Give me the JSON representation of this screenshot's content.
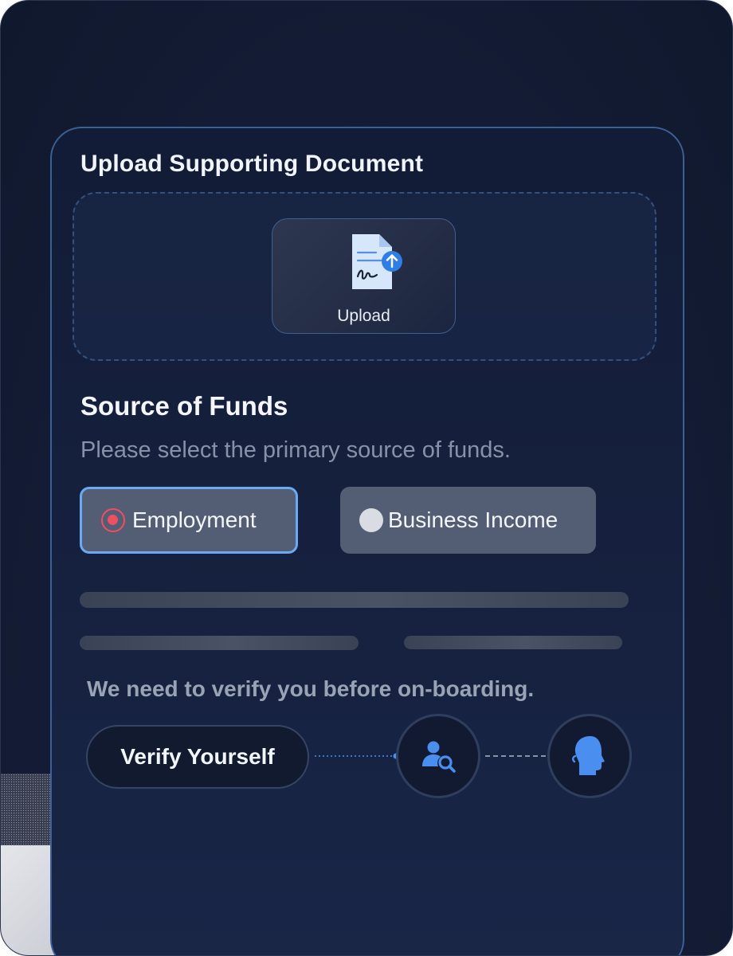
{
  "upload": {
    "title": "Upload Supporting Document",
    "button_label": "Upload",
    "icon": "document-upload-icon"
  },
  "source_of_funds": {
    "title": "Source of Funds",
    "subtitle": "Please select the primary source of funds.",
    "options": [
      {
        "label": "Employment",
        "selected": true
      },
      {
        "label": "Business Income",
        "selected": false
      }
    ]
  },
  "verification": {
    "message": "We need to verify you before on-boarding.",
    "button_label": "Verify Yourself",
    "icons": [
      "user-search-icon",
      "face-profile-icon"
    ]
  },
  "colors": {
    "accent_blue": "#4a8ff0",
    "selected_radio": "#ef4f62",
    "card_border": "#3c5f95"
  }
}
